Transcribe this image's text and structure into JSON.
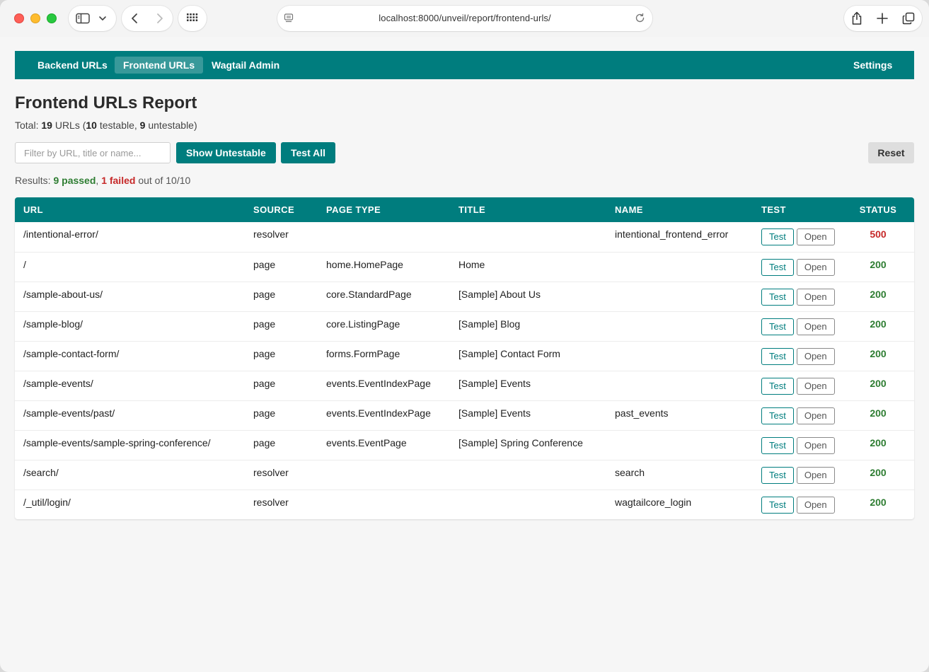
{
  "browser": {
    "url": "localhost:8000/unveil/report/frontend-urls/"
  },
  "nav": {
    "items": [
      {
        "label": "Backend URLs",
        "active": false
      },
      {
        "label": "Frontend URLs",
        "active": true
      },
      {
        "label": "Wagtail Admin",
        "active": false
      }
    ],
    "settings_label": "Settings"
  },
  "page": {
    "title": "Frontend URLs Report",
    "summary": {
      "prefix": "Total: ",
      "total": "19",
      "urls_label": " URLs (",
      "testable": "10",
      "testable_label": " testable, ",
      "untestable": "9",
      "untestable_label": " untestable)"
    }
  },
  "toolbar": {
    "filter_placeholder": "Filter by URL, title or name...",
    "filter_value": "",
    "show_untestable_label": "Show Untestable",
    "test_all_label": "Test All",
    "reset_label": "Reset"
  },
  "results": {
    "prefix": "Results: ",
    "passed": "9 passed",
    "sep": ", ",
    "failed": "1 failed",
    "suffix": " out of 10/10"
  },
  "table": {
    "headers": {
      "url": "URL",
      "source": "SOURCE",
      "page_type": "PAGE TYPE",
      "title": "TITLE",
      "name": "NAME",
      "test": "TEST",
      "status": "STATUS"
    },
    "test_label": "Test",
    "open_label": "Open",
    "rows": [
      {
        "url": "/intentional-error/",
        "source": "resolver",
        "page_type": "",
        "title": "",
        "name": "intentional_frontend_error",
        "status": "500"
      },
      {
        "url": "/",
        "source": "page",
        "page_type": "home.HomePage",
        "title": "Home",
        "name": "",
        "status": "200"
      },
      {
        "url": "/sample-about-us/",
        "source": "page",
        "page_type": "core.StandardPage",
        "title": "[Sample] About Us",
        "name": "",
        "status": "200"
      },
      {
        "url": "/sample-blog/",
        "source": "page",
        "page_type": "core.ListingPage",
        "title": "[Sample] Blog",
        "name": "",
        "status": "200"
      },
      {
        "url": "/sample-contact-form/",
        "source": "page",
        "page_type": "forms.FormPage",
        "title": "[Sample] Contact Form",
        "name": "",
        "status": "200"
      },
      {
        "url": "/sample-events/",
        "source": "page",
        "page_type": "events.EventIndexPage",
        "title": "[Sample] Events",
        "name": "",
        "status": "200"
      },
      {
        "url": "/sample-events/past/",
        "source": "page",
        "page_type": "events.EventIndexPage",
        "title": "[Sample] Events",
        "name": "past_events",
        "status": "200"
      },
      {
        "url": "/sample-events/sample-spring-conference/",
        "source": "page",
        "page_type": "events.EventPage",
        "title": "[Sample] Spring Conference",
        "name": "",
        "status": "200"
      },
      {
        "url": "/search/",
        "source": "resolver",
        "page_type": "",
        "title": "",
        "name": "search",
        "status": "200"
      },
      {
        "url": "/_util/login/",
        "source": "resolver",
        "page_type": "",
        "title": "",
        "name": "wagtailcore_login",
        "status": "200"
      }
    ]
  },
  "colors": {
    "brand": "#007d7e",
    "pass": "#2e7d32",
    "fail": "#c62828"
  },
  "icons": [
    "sidebar-icon",
    "chevron-down-icon",
    "back-icon",
    "forward-icon",
    "grid-icon",
    "page-icon",
    "reload-icon",
    "share-icon",
    "plus-icon",
    "tabs-icon"
  ]
}
